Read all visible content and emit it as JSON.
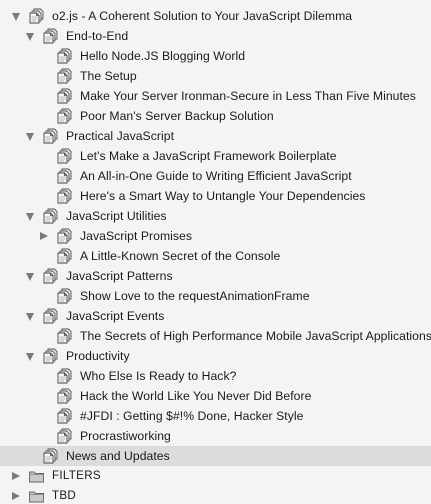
{
  "outline": {
    "rows": [
      {
        "label": "o2.js - A Coherent Solution to Your JavaScript Dilemma",
        "depth": 0,
        "expander": "open",
        "icon": "stacked-document-icon"
      },
      {
        "label": "End-to-End",
        "depth": 1,
        "expander": "open",
        "icon": "stacked-document-icon"
      },
      {
        "label": "Hello Node.JS Blogging World",
        "depth": 2,
        "expander": "none",
        "icon": "stacked-document-icon"
      },
      {
        "label": "The Setup",
        "depth": 2,
        "expander": "none",
        "icon": "stacked-document-icon"
      },
      {
        "label": "Make Your Server Ironman-Secure in Less Than Five Minutes",
        "depth": 2,
        "expander": "none",
        "icon": "stacked-document-icon"
      },
      {
        "label": "Poor Man's Server Backup Solution",
        "depth": 2,
        "expander": "none",
        "icon": "stacked-document-icon"
      },
      {
        "label": "Practical JavaScript",
        "depth": 1,
        "expander": "open",
        "icon": "stacked-document-icon"
      },
      {
        "label": "Let's Make a JavaScript Framework Boilerplate",
        "depth": 2,
        "expander": "none",
        "icon": "stacked-document-icon"
      },
      {
        "label": "An All-in-One Guide to Writing Efficient JavaScript",
        "depth": 2,
        "expander": "none",
        "icon": "stacked-document-icon"
      },
      {
        "label": "Here's a Smart Way to Untangle Your Dependencies",
        "depth": 2,
        "expander": "none",
        "icon": "stacked-document-icon"
      },
      {
        "label": "JavaScript Utilities",
        "depth": 1,
        "expander": "open",
        "icon": "stacked-document-icon"
      },
      {
        "label": "JavaScript Promises",
        "depth": 2,
        "expander": "closed",
        "icon": "stacked-document-icon"
      },
      {
        "label": "A Little-Known Secret of the Console",
        "depth": 2,
        "expander": "none",
        "icon": "stacked-document-icon"
      },
      {
        "label": "JavaScript Patterns",
        "depth": 1,
        "expander": "open",
        "icon": "stacked-document-icon"
      },
      {
        "label": "Show Love to the requestAnimationFrame",
        "depth": 2,
        "expander": "none",
        "icon": "stacked-document-icon"
      },
      {
        "label": "JavaScript Events",
        "depth": 1,
        "expander": "open",
        "icon": "stacked-document-icon"
      },
      {
        "label": "The Secrets of High Performance Mobile JavaScript Applications",
        "depth": 2,
        "expander": "none",
        "icon": "stacked-document-icon"
      },
      {
        "label": "Productivity",
        "depth": 1,
        "expander": "open",
        "icon": "stacked-document-icon"
      },
      {
        "label": "Who Else Is Ready to Hack?",
        "depth": 2,
        "expander": "none",
        "icon": "stacked-document-icon"
      },
      {
        "label": "Hack the World Like You Never Did Before",
        "depth": 2,
        "expander": "none",
        "icon": "stacked-document-icon"
      },
      {
        "label": "#JFDI : Getting $#!% Done, Hacker Style",
        "depth": 2,
        "expander": "none",
        "icon": "stacked-document-icon"
      },
      {
        "label": "Procrastiworking",
        "depth": 2,
        "expander": "none",
        "icon": "stacked-document-icon"
      },
      {
        "label": "News and Updates",
        "depth": 1,
        "expander": "none",
        "icon": "stacked-document-icon",
        "selected": true
      },
      {
        "label": "FILTERS",
        "depth": 0,
        "expander": "closed",
        "icon": "folder-icon"
      },
      {
        "label": "TBD",
        "depth": 0,
        "expander": "closed",
        "icon": "folder-icon"
      }
    ]
  },
  "colors": {
    "background": "#f4f4f4",
    "selection": "#dcdcdc",
    "text": "#1a1a1a",
    "disclosure": "#7a7a7a"
  }
}
